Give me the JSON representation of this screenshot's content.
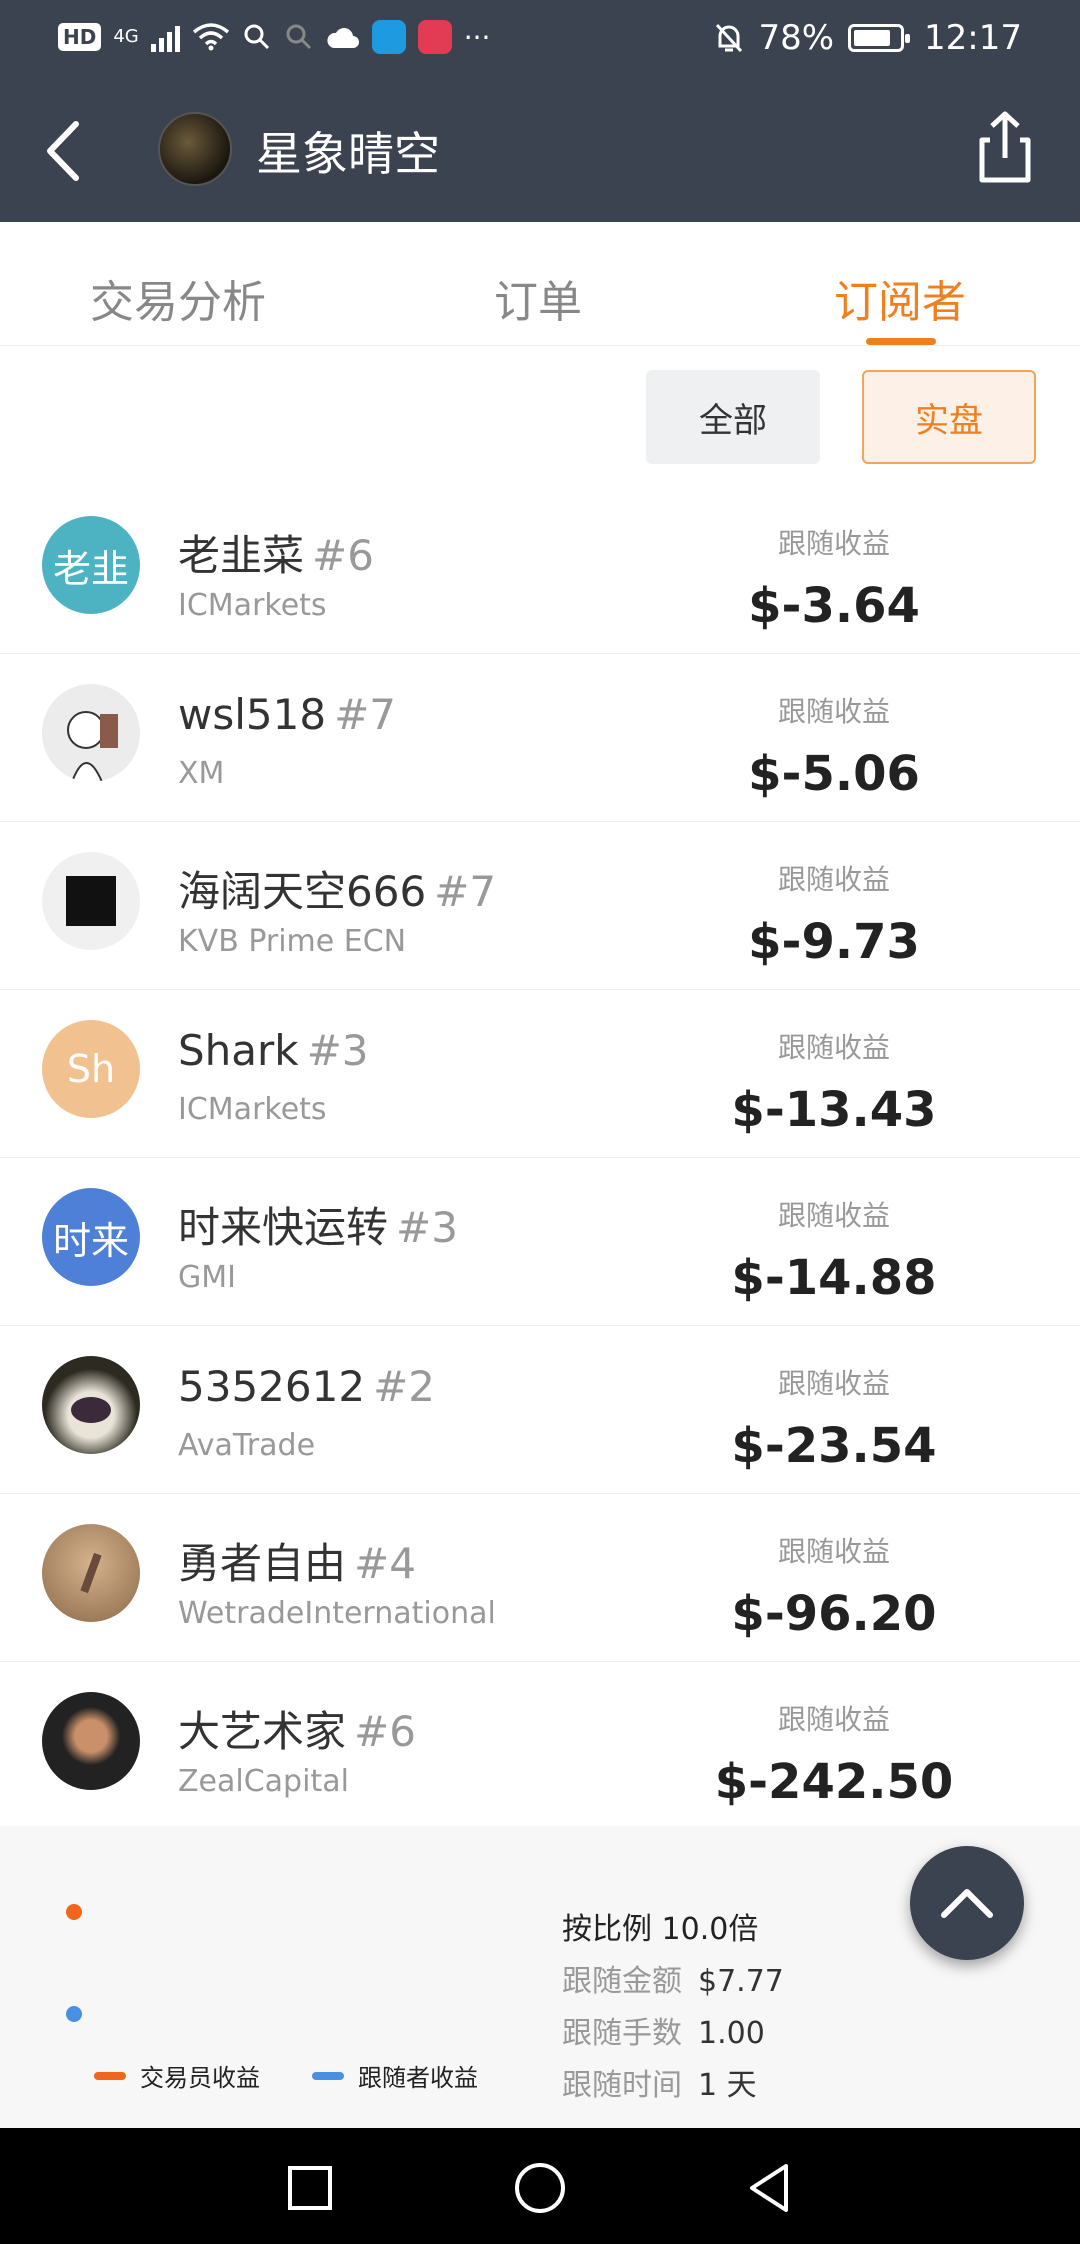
{
  "status_bar": {
    "hd": "HD",
    "network": "4G",
    "dnd_icon": "bell-off-icon",
    "battery": "78%",
    "time": "12:17",
    "more": "···"
  },
  "header": {
    "title": "星象晴空"
  },
  "tabs": [
    {
      "label": "交易分析",
      "active": false
    },
    {
      "label": "订单",
      "active": false
    },
    {
      "label": "订阅者",
      "active": true
    }
  ],
  "filters": {
    "all": "全部",
    "real": "实盘"
  },
  "subscribers": [
    {
      "name": "老韭菜",
      "rank": "#6",
      "broker": "ICMarkets",
      "profit_label": "跟随收益",
      "profit": "$-3.64",
      "avatar_text": "老韭",
      "avatar_color": "#4db3c2"
    },
    {
      "name": "wsl518",
      "rank": "#7",
      "broker": "XM",
      "profit_label": "跟随收益",
      "profit": "$-5.06",
      "avatar_text": "",
      "avatar_color": "#e9e9e9"
    },
    {
      "name": "海阔天空666",
      "rank": "#7",
      "broker": "KVB Prime ECN",
      "profit_label": "跟随收益",
      "profit": "$-9.73",
      "avatar_text": "",
      "avatar_color": "#f0f0f0"
    },
    {
      "name": "Shark",
      "rank": "#3",
      "broker": "ICMarkets",
      "profit_label": "跟随收益",
      "profit": "$-13.43",
      "avatar_text": "Sh",
      "avatar_color": "#f1c28f"
    },
    {
      "name": "时来快运转",
      "rank": "#3",
      "broker": "GMI",
      "profit_label": "跟随收益",
      "profit": "$-14.88",
      "avatar_text": "时来",
      "avatar_color": "#4f80d8"
    },
    {
      "name": "5352612",
      "rank": "#2",
      "broker": "AvaTrade",
      "profit_label": "跟随收益",
      "profit": "$-23.54",
      "avatar_text": "",
      "avatar_color": "#3a3a30"
    },
    {
      "name": "勇者自由",
      "rank": "#4",
      "broker": "WetradeInternational",
      "profit_label": "跟随收益",
      "profit": "$-96.20",
      "avatar_text": "",
      "avatar_color": "#b8906a"
    },
    {
      "name": "大艺术家",
      "rank": "#6",
      "broker": "ZealCapital",
      "profit_label": "跟随收益",
      "profit": "$-242.50",
      "avatar_text": "",
      "avatar_color": "#2b2b2b"
    }
  ],
  "panel": {
    "legend_trader": "交易员收益",
    "legend_follower": "跟随者收益",
    "ratio": "按比例 10.0倍",
    "follow_amount_label": "跟随金额",
    "follow_amount": "$7.77",
    "follow_lots_label": "跟随手数",
    "follow_lots": "1.00",
    "follow_time_label": "跟随时间",
    "follow_time": "1 天",
    "colors": {
      "trader": "#f0661a",
      "follower": "#4a90e2"
    }
  },
  "accent": "#f07f1f"
}
